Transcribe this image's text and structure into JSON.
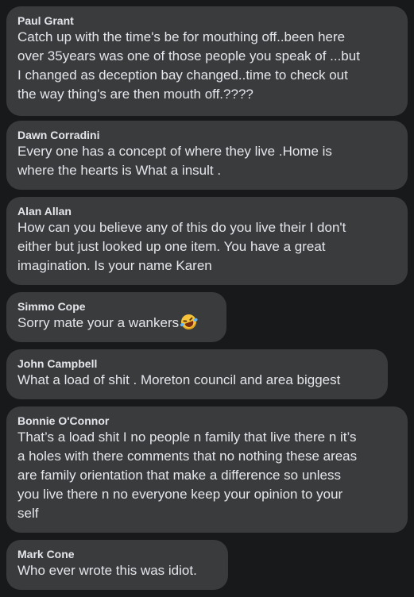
{
  "comments": [
    {
      "author": "Paul Grant",
      "lines": [
        "Catch up with the time's be for mouthing off..been here",
        "over 35years was one of those people you speak of ...but",
        "I changed as deception bay changed..time to check out",
        "the way thing's are then mouth off.????"
      ]
    },
    {
      "author": "Dawn Corradini",
      "lines": [
        "Every one has a concept of where they live .Home is",
        "where the hearts is What a insult ."
      ]
    },
    {
      "author": "Alan Allan",
      "lines": [
        "How can you believe any of this do you live their I don't",
        "either but just looked up one item. You have a great",
        "imagination. Is your name Karen"
      ]
    },
    {
      "author": "Simmo Cope",
      "lines": [
        "Sorry mate your a wankers"
      ],
      "emoji": "rolling-on-floor-laughing-emoji"
    },
    {
      "author": "John Campbell",
      "lines": [
        "What a load of shit . Moreton council and area biggest"
      ]
    },
    {
      "author": "Bonnie O'Connor",
      "lines": [
        "That’s a load shit I no people n family that live there n it’s",
        "a holes with there comments that no nothing these areas",
        "are family orientation that make a difference so unless",
        "you live there n no everyone keep your opinion to your",
        "self"
      ]
    },
    {
      "author": "Mark Cone",
      "lines": [
        "Who ever wrote this was idiot."
      ]
    }
  ],
  "colors": {
    "page_background": "#18191a",
    "bubble_background": "#3a3b3c",
    "text": "#e4e6eb"
  }
}
